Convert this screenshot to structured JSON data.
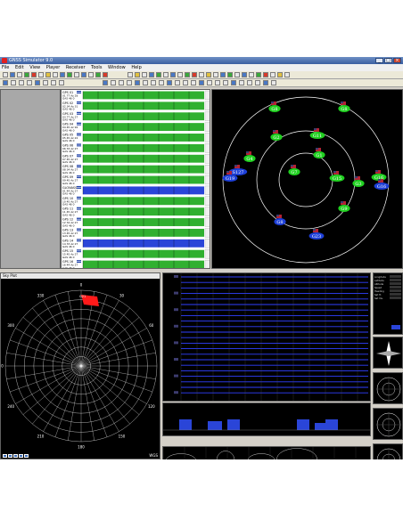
{
  "window": {
    "title": "GNSS Simulator 9.0"
  },
  "menu": [
    "File",
    "Edit",
    "View",
    "Player",
    "Receiver",
    "Tools",
    "Window",
    "Help"
  ],
  "satellites": [
    {
      "id": "GPS 01",
      "lines": [
        "01 77 Az 28",
        "GAS 46 0"
      ]
    },
    {
      "id": "GPS 02",
      "lines": [
        "02 34 Az 31",
        "GAS 46 0"
      ]
    },
    {
      "id": "GPS 03",
      "lines": [
        "03 77 Az 27",
        "GAS 46 0"
      ]
    },
    {
      "id": "GPS 04",
      "lines": [
        "04 45 Az 92",
        "GAS 46 0"
      ]
    },
    {
      "id": "GPS 05",
      "lines": [
        "05 45 Az 22",
        "GAS 46 0"
      ]
    },
    {
      "id": "GPS 06",
      "lines": [
        "06 33 Az 27",
        "GAS 46 0"
      ]
    },
    {
      "id": "GPS 07",
      "lines": [
        "07 45 Az 27",
        "GAS 46 0"
      ]
    },
    {
      "id": "GPS 08",
      "lines": [
        "08 34 Az 27",
        "GAS 46 0"
      ]
    },
    {
      "id": "GPS 09",
      "lines": [
        "09 45 Az 27",
        "GAS 46 0"
      ]
    },
    {
      "id": "GLONASS",
      "lines": [
        "01 44 Az 27",
        "GAS 46 0"
      ]
    },
    {
      "id": "GPS 10",
      "lines": [
        "10 45 Az 27",
        "GAS 46 0"
      ]
    },
    {
      "id": "GPS 11",
      "lines": [
        "11 45 Az 27",
        "GAS 46 0"
      ]
    },
    {
      "id": "GPS 12",
      "lines": [
        "12 34 Az 27",
        "GAS 46 0"
      ]
    },
    {
      "id": "GPS 13",
      "lines": [
        "13 45 Az 27",
        "GAS 46 0"
      ]
    },
    {
      "id": "GPS 14",
      "lines": [
        "14 33 Az 27",
        "GAS 46 0"
      ]
    },
    {
      "id": "GPS 15",
      "lines": [
        "15 45 Az 27",
        "GAS 46 0"
      ]
    },
    {
      "id": "GPS 16",
      "lines": [
        "16 44 Az 27",
        "GAS 46 0"
      ]
    }
  ],
  "bars": [
    {
      "color": "#30b030"
    },
    {
      "color": "#30b030"
    },
    {
      "color": "#30b030"
    },
    {
      "color": "#30b030"
    },
    {
      "color": "#30b030"
    },
    {
      "color": "#30b030"
    },
    {
      "color": "#30b030"
    },
    {
      "color": "#30b030"
    },
    {
      "color": "#30b030"
    },
    {
      "color": "#2a45d8"
    },
    {
      "color": "#30b030"
    },
    {
      "color": "#30b030"
    },
    {
      "color": "#30b030"
    },
    {
      "color": "#30b030"
    },
    {
      "color": "#2a45d8"
    },
    {
      "color": "#30b030"
    },
    {
      "color": "#30b030"
    }
  ],
  "skyplot": {
    "satellites": [
      {
        "label": "G8",
        "kind": "green"
      },
      {
        "label": "G8",
        "kind": "green"
      },
      {
        "label": "G16",
        "kind": "green"
      },
      {
        "label": "G11",
        "kind": "green"
      },
      {
        "label": "G1",
        "kind": "green"
      },
      {
        "label": "G2",
        "kind": "green"
      },
      {
        "label": "G7",
        "kind": "green"
      },
      {
        "label": "G4",
        "kind": "green"
      },
      {
        "label": "G15",
        "kind": "green"
      },
      {
        "label": "G3",
        "kind": "green"
      },
      {
        "label": "G9",
        "kind": "green"
      },
      {
        "label": "S127",
        "kind": "blue"
      },
      {
        "label": "G19",
        "kind": "blue"
      },
      {
        "label": "G16",
        "kind": "blue"
      },
      {
        "label": "G8",
        "kind": "blue"
      },
      {
        "label": "G23",
        "kind": "blue"
      }
    ]
  },
  "polar": {
    "title": "Sky Plot",
    "marker": "G21",
    "azimuths": [
      "0",
      "30",
      "60",
      "90",
      "120",
      "150",
      "180",
      "210",
      "240",
      "270",
      "300",
      "330"
    ],
    "status_left": "100 %",
    "status_right": "WGS"
  },
  "side": {
    "legend": [
      "Longitude",
      "Latitude",
      "Altitude",
      "Speed",
      "Heading",
      "Sat Tr.",
      "Sat Vis."
    ]
  }
}
